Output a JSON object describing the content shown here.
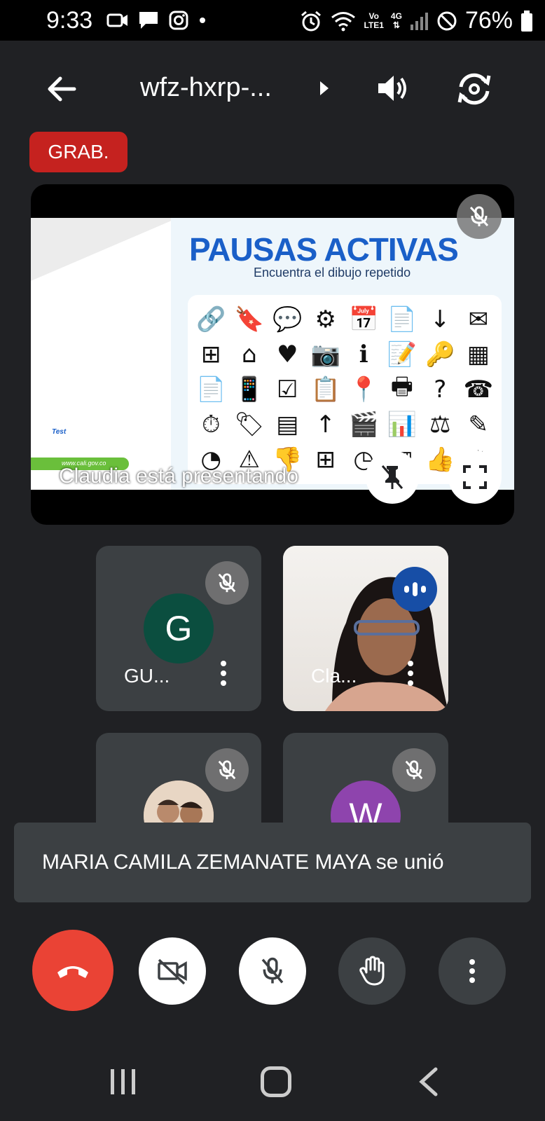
{
  "status_bar": {
    "time": "9:33",
    "network_top": "Vo",
    "network_bottom": "LTE1",
    "signal": "4G",
    "battery": "76%"
  },
  "top_bar": {
    "meeting_code": "wfz-hxrp-...",
    "icons": [
      "back-arrow-icon",
      "caret-right-icon",
      "speaker-icon",
      "switch-camera-icon"
    ]
  },
  "recording_badge": "GRAB.",
  "presentation": {
    "slide_title": "PAUSAS ACTIVAS",
    "slide_subtitle": "Encuentra el dibujo repetido",
    "slide_test_label": "Test",
    "slide_url": "www.cali.gov.co",
    "grid_icons": [
      "🔗",
      "🔖",
      "💬",
      "⚙",
      "📅",
      "📄",
      "↓",
      "✉",
      "⊞",
      "⌂",
      "♥",
      "📷",
      "ℹ",
      "📝",
      "🔑",
      "▦",
      "📄",
      "📱",
      "☑",
      "📋",
      "📍",
      "🖶",
      "?",
      "☎",
      "⏱",
      "🏷",
      "▤",
      "↑",
      "🎬",
      "📊",
      "⚖",
      "✎",
      "◔",
      "⚠",
      "👎",
      "⊞",
      "◷",
      "▥",
      "👍",
      "✹"
    ],
    "presenting_label": "Claudia está presentando"
  },
  "participants": [
    {
      "name": "GU...",
      "avatar_letter": "G",
      "muted": true
    },
    {
      "name": "Cla...",
      "speaking": true
    },
    {
      "name": "",
      "photo": true,
      "muted": true
    },
    {
      "name": "",
      "avatar_letter": "W",
      "muted": true
    }
  ],
  "toast": {
    "message": "MARIA CAMILA ZEMANATE MAYA se unió"
  },
  "controls": [
    "end-call",
    "camera-off",
    "mic-off",
    "raise-hand",
    "more-options"
  ],
  "colors": {
    "end_call": "#ea4335",
    "recording": "#c5221f",
    "speaking": "#174ea6",
    "avatar_g": "#0b4e3f",
    "avatar_w": "#8e44ad"
  }
}
